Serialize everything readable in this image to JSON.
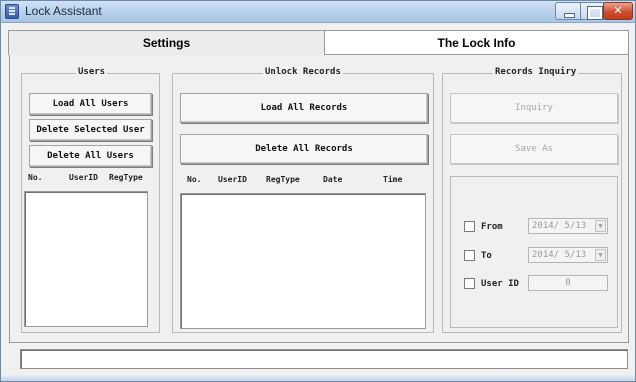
{
  "window": {
    "title": "Lock Assistant"
  },
  "tabs": [
    {
      "label": "Settings"
    },
    {
      "label": "The Lock Info"
    }
  ],
  "users": {
    "title": "Users",
    "load_all": "Load All Users",
    "delete_selected": "Delete Selected User",
    "delete_all": "Delete All Users",
    "columns": [
      "No.",
      "UserID",
      "RegType"
    ]
  },
  "unlock_records": {
    "title": "Unlock Records",
    "load_all": "Load All Records",
    "delete_all": "Delete All Records",
    "columns": [
      "No.",
      "UserID",
      "RegType",
      "Date",
      "Time"
    ]
  },
  "records_inquiry": {
    "title": "Records Inquiry",
    "inquiry": "Inquiry",
    "save_as": "Save As",
    "from_label": "From",
    "from_value": "2014/ 5/13",
    "to_label": "To",
    "to_value": "2014/ 5/13",
    "userid_label": "User ID",
    "userid_value": "0"
  }
}
